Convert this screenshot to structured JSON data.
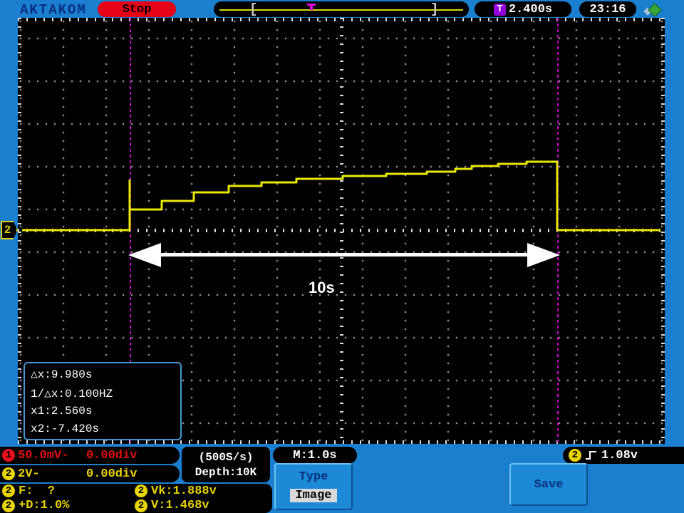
{
  "header": {
    "brand": "AKTAKOM",
    "run_state": "Stop",
    "memory_bar": {
      "left_bracket": "[",
      "right_bracket": "]"
    },
    "trigger_icon": "T",
    "trigger_time": "2.400s",
    "clock": "23:16"
  },
  "scope": {
    "channel_marker": "2",
    "arrow_label": "10s",
    "cursor_readout": {
      "line1": "△x:9.980s",
      "line2": "1/△x:0.100HZ",
      "line3": "x1:2.560s",
      "line4": "x2:-7.420s"
    },
    "waveform": {
      "color": "#e8e800",
      "points": [
        [
          6,
          298
        ],
        [
          157,
          298
        ],
        [
          157,
          228
        ],
        [
          157,
          269
        ],
        [
          202,
          269
        ],
        [
          202,
          257
        ],
        [
          247,
          257
        ],
        [
          247,
          245
        ],
        [
          296,
          245
        ],
        [
          296,
          236
        ],
        [
          342,
          236
        ],
        [
          342,
          231
        ],
        [
          391,
          231
        ],
        [
          391,
          226
        ],
        [
          456,
          226
        ],
        [
          456,
          222
        ],
        [
          517,
          222
        ],
        [
          517,
          219
        ],
        [
          574,
          219
        ],
        [
          574,
          216
        ],
        [
          614,
          216
        ],
        [
          614,
          212
        ],
        [
          637,
          212
        ],
        [
          637,
          208
        ],
        [
          674,
          208
        ],
        [
          674,
          205
        ],
        [
          714,
          205
        ],
        [
          714,
          202
        ],
        [
          757,
          202
        ],
        [
          757,
          298
        ],
        [
          902,
          298
        ]
      ]
    }
  },
  "status": {
    "ch1": {
      "num": "1",
      "scale": "50.0mV-",
      "offset": "0.00div"
    },
    "ch2": {
      "num": "2",
      "scale": "2V-",
      "offset": "0.00div"
    },
    "sample_rate": "(500S/s)",
    "depth": "Depth:10K",
    "timebase": "M:1.0s",
    "trigger": {
      "num": "2",
      "level": "1.08v"
    },
    "measurements": [
      {
        "num": "2",
        "text": "F:  ?"
      },
      {
        "num": "2",
        "text": "Vk:1.888v"
      },
      {
        "num": "2",
        "text": "+D:1.0%"
      },
      {
        "num": "2",
        "text": "V:1.468v"
      }
    ]
  },
  "menu": {
    "type_label": "Type",
    "type_value": "Image",
    "save_label": "Save"
  }
}
